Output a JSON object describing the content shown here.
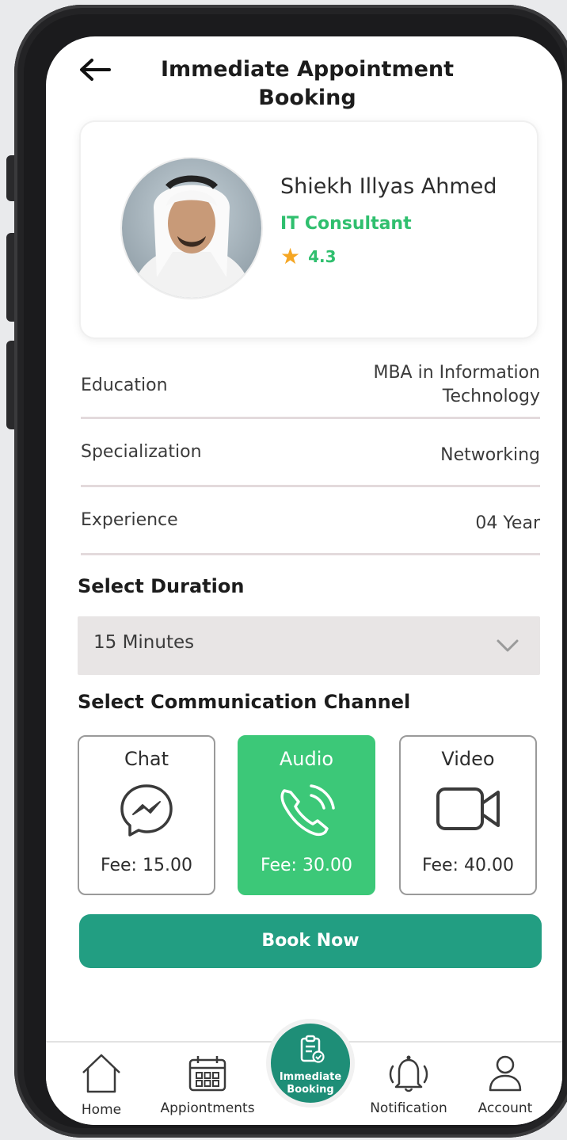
{
  "header": {
    "title": "Immediate Appointment Booking"
  },
  "profile": {
    "name": "Shiekh Illyas Ahmed",
    "role": "IT Consultant",
    "rating": "4.3"
  },
  "info_rows": [
    {
      "label": "Education",
      "value": "MBA in Information Technology"
    },
    {
      "label": "Specialization",
      "value": "Networking"
    },
    {
      "label": "Experience",
      "value": "04 Year"
    }
  ],
  "duration": {
    "title": "Select Duration",
    "selected": "15 Minutes"
  },
  "channels": {
    "title": "Select Communication Channel",
    "items": [
      {
        "name": "Chat",
        "fee": "Fee: 15.00",
        "icon": "messenger-icon",
        "selected": false
      },
      {
        "name": "Audio",
        "fee": "Fee: 30.00",
        "icon": "phone-call-icon",
        "selected": true
      },
      {
        "name": "Video",
        "fee": "Fee: 40.00",
        "icon": "video-camera-icon",
        "selected": false
      }
    ]
  },
  "book_button": "Book Now",
  "nav": {
    "home": "Home",
    "appointments": "Appiontments",
    "center": "Immediate Booking",
    "notification": "Notification",
    "account": "Account"
  },
  "colors": {
    "accent_green": "#3cc878",
    "button_teal": "#229e82",
    "fab_teal": "#1e8e77",
    "star": "#f5a623"
  }
}
